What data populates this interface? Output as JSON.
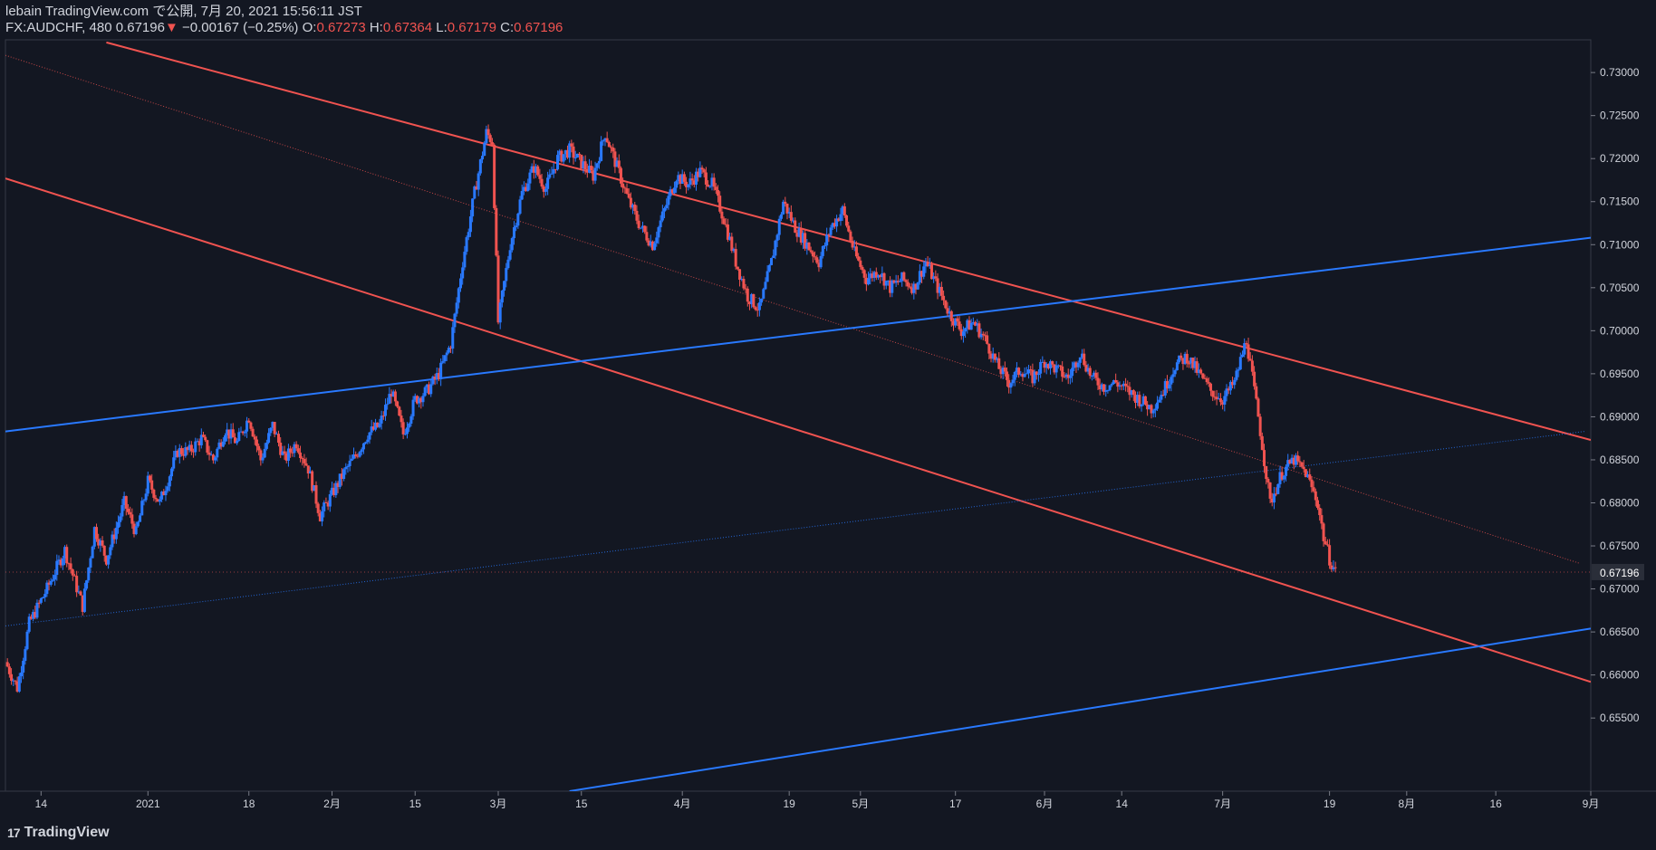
{
  "header": {
    "publish_line": "lebain TradingView.com で公開, 7月 20, 2021 15:56:11 JST",
    "symbol": "FX:AUDCHF, 480",
    "last": "0.67196",
    "down_arrow": "▼",
    "change": "−0.00167 (−0.25%)",
    "o_label": "O:",
    "o_value": "0.67273",
    "h_label": "H:",
    "h_value": "0.67364",
    "l_label": "L:",
    "l_value": "0.67179",
    "c_label": "C:",
    "c_value": "0.67196"
  },
  "footer": {
    "logo_text": "TradingView",
    "logo_mark": "17"
  },
  "colors": {
    "background": "#131722",
    "up": "#2979ff",
    "down": "#f05350",
    "axis_text": "#d1d4dc",
    "price_tag_bg": "#2a2e39"
  },
  "chart_data": {
    "type": "candlestick",
    "symbol": "FX:AUDCHF",
    "interval": "480",
    "price_axis": {
      "range": [
        0.6465,
        0.7338
      ],
      "ticks": [
        "0.73000",
        "0.72500",
        "0.72000",
        "0.71500",
        "0.71000",
        "0.70500",
        "0.70000",
        "0.69500",
        "0.69000",
        "0.68500",
        "0.68000",
        "0.67500",
        "0.67000",
        "0.66500",
        "0.66000",
        "0.65500"
      ],
      "current_price_label": "0.67196"
    },
    "time_axis": {
      "range": [
        "2020-12-08",
        "2021-09-01"
      ],
      "ticks": [
        {
          "date": "2020-12-14",
          "label": "14"
        },
        {
          "date": "2021-01-01",
          "label": "2021"
        },
        {
          "date": "2021-01-18",
          "label": "18"
        },
        {
          "date": "2021-02-01",
          "label": "2月"
        },
        {
          "date": "2021-02-15",
          "label": "15"
        },
        {
          "date": "2021-03-01",
          "label": "3月"
        },
        {
          "date": "2021-03-15",
          "label": "15"
        },
        {
          "date": "2021-04-01",
          "label": "4月"
        },
        {
          "date": "2021-04-19",
          "label": "19"
        },
        {
          "date": "2021-05-01",
          "label": "5月"
        },
        {
          "date": "2021-05-17",
          "label": "17"
        },
        {
          "date": "2021-06-01",
          "label": "6月"
        },
        {
          "date": "2021-06-14",
          "label": "14"
        },
        {
          "date": "2021-07-01",
          "label": "7月"
        },
        {
          "date": "2021-07-19",
          "label": "19"
        },
        {
          "date": "2021-08-01",
          "label": "8月"
        },
        {
          "date": "2021-08-16",
          "label": "16"
        },
        {
          "date": "2021-09-01",
          "label": "9月"
        }
      ]
    },
    "price_path": [
      [
        "2020-12-08",
        0.6615
      ],
      [
        "2020-12-10",
        0.6585
      ],
      [
        "2020-12-12",
        0.666
      ],
      [
        "2020-12-15",
        0.67
      ],
      [
        "2020-12-18",
        0.6745
      ],
      [
        "2020-12-21",
        0.668
      ],
      [
        "2020-12-23",
        0.677
      ],
      [
        "2020-12-25",
        0.6735
      ],
      [
        "2020-12-28",
        0.68
      ],
      [
        "2020-12-30",
        0.6765
      ],
      [
        "2021-01-01",
        0.6825
      ],
      [
        "2021-01-03",
        0.68
      ],
      [
        "2021-01-06",
        0.686
      ],
      [
        "2021-01-08",
        0.686
      ],
      [
        "2021-01-10",
        0.6875
      ],
      [
        "2021-01-12",
        0.685
      ],
      [
        "2021-01-14",
        0.6885
      ],
      [
        "2021-01-16",
        0.687
      ],
      [
        "2021-01-18",
        0.69
      ],
      [
        "2021-01-20",
        0.685
      ],
      [
        "2021-01-22",
        0.689
      ],
      [
        "2021-01-24",
        0.685
      ],
      [
        "2021-01-26",
        0.687
      ],
      [
        "2021-01-28",
        0.684
      ],
      [
        "2021-01-30",
        0.6785
      ],
      [
        "2021-02-01",
        0.681
      ],
      [
        "2021-02-03",
        0.6835
      ],
      [
        "2021-02-05",
        0.6855
      ],
      [
        "2021-02-07",
        0.688
      ],
      [
        "2021-02-09",
        0.689
      ],
      [
        "2021-02-11",
        0.693
      ],
      [
        "2021-02-13",
        0.688
      ],
      [
        "2021-02-15",
        0.692
      ],
      [
        "2021-02-17",
        0.693
      ],
      [
        "2021-02-19",
        0.695
      ],
      [
        "2021-02-21",
        0.6985
      ],
      [
        "2021-02-23",
        0.708
      ],
      [
        "2021-02-25",
        0.716
      ],
      [
        "2021-02-27",
        0.723
      ],
      [
        "2021-02-28",
        0.722
      ],
      [
        "2021-03-01",
        0.701
      ],
      [
        "2021-03-03",
        0.71
      ],
      [
        "2021-03-05",
        0.716
      ],
      [
        "2021-03-07",
        0.719
      ],
      [
        "2021-03-09",
        0.7165
      ],
      [
        "2021-03-11",
        0.72
      ],
      [
        "2021-03-13",
        0.721
      ],
      [
        "2021-03-15",
        0.7195
      ],
      [
        "2021-03-17",
        0.718
      ],
      [
        "2021-03-19",
        0.723
      ],
      [
        "2021-03-21",
        0.719
      ],
      [
        "2021-03-23",
        0.715
      ],
      [
        "2021-03-25",
        0.712
      ],
      [
        "2021-03-27",
        0.71
      ],
      [
        "2021-03-29",
        0.714
      ],
      [
        "2021-03-31",
        0.718
      ],
      [
        "2021-04-02",
        0.717
      ],
      [
        "2021-04-04",
        0.7185
      ],
      [
        "2021-04-06",
        0.717
      ],
      [
        "2021-04-08",
        0.713
      ],
      [
        "2021-04-10",
        0.708
      ],
      [
        "2021-04-12",
        0.704
      ],
      [
        "2021-04-14",
        0.7025
      ],
      [
        "2021-04-16",
        0.708
      ],
      [
        "2021-04-18",
        0.715
      ],
      [
        "2021-04-20",
        0.712
      ],
      [
        "2021-04-22",
        0.71
      ],
      [
        "2021-04-24",
        0.708
      ],
      [
        "2021-04-26",
        0.712
      ],
      [
        "2021-04-28",
        0.714
      ],
      [
        "2021-04-30",
        0.709
      ],
      [
        "2021-05-02",
        0.706
      ],
      [
        "2021-05-04",
        0.707
      ],
      [
        "2021-05-06",
        0.705
      ],
      [
        "2021-05-08",
        0.706
      ],
      [
        "2021-05-10",
        0.705
      ],
      [
        "2021-05-12",
        0.708
      ],
      [
        "2021-05-14",
        0.705
      ],
      [
        "2021-05-16",
        0.702
      ],
      [
        "2021-05-18",
        0.7
      ],
      [
        "2021-05-20",
        0.701
      ],
      [
        "2021-05-22",
        0.699
      ],
      [
        "2021-05-24",
        0.696
      ],
      [
        "2021-05-26",
        0.694
      ],
      [
        "2021-05-28",
        0.6955
      ],
      [
        "2021-05-30",
        0.6945
      ],
      [
        "2021-06-01",
        0.6965
      ],
      [
        "2021-06-03",
        0.6955
      ],
      [
        "2021-06-05",
        0.6945
      ],
      [
        "2021-06-07",
        0.6975
      ],
      [
        "2021-06-09",
        0.6945
      ],
      [
        "2021-06-11",
        0.6935
      ],
      [
        "2021-06-13",
        0.694
      ],
      [
        "2021-06-15",
        0.693
      ],
      [
        "2021-06-17",
        0.692
      ],
      [
        "2021-06-19",
        0.691
      ],
      [
        "2021-06-21",
        0.693
      ],
      [
        "2021-06-23",
        0.696
      ],
      [
        "2021-06-25",
        0.697
      ],
      [
        "2021-06-27",
        0.695
      ],
      [
        "2021-06-29",
        0.693
      ],
      [
        "2021-07-01",
        0.692
      ],
      [
        "2021-07-03",
        0.694
      ],
      [
        "2021-07-05",
        0.699
      ],
      [
        "2021-07-07",
        0.69
      ],
      [
        "2021-07-09",
        0.68
      ],
      [
        "2021-07-11",
        0.6835
      ],
      [
        "2021-07-13",
        0.685
      ],
      [
        "2021-07-15",
        0.6835
      ],
      [
        "2021-07-17",
        0.68
      ],
      [
        "2021-07-18",
        0.676
      ],
      [
        "2021-07-19",
        0.6735
      ],
      [
        "2021-07-20",
        0.672
      ]
    ],
    "trendlines": [
      {
        "color": "down",
        "style": "solid",
        "start": {
          "date": "2020-12-25",
          "price": 0.7335
        },
        "end": {
          "date": "2021-09-01",
          "price": 0.6873
        }
      },
      {
        "color": "down",
        "style": "solid",
        "start": {
          "date": "2020-12-08",
          "price": 0.7177
        },
        "end": {
          "date": "2021-09-01",
          "price": 0.6592
        }
      },
      {
        "color": "down",
        "style": "dotted",
        "start": {
          "date": "2020-12-08",
          "price": 0.732
        },
        "end": {
          "date": "2021-08-30",
          "price": 0.673
        }
      },
      {
        "color": "up",
        "style": "solid",
        "start": {
          "date": "2020-12-08",
          "price": 0.6883
        },
        "end": {
          "date": "2021-09-01",
          "price": 0.7108
        }
      },
      {
        "color": "up",
        "style": "solid",
        "start": {
          "date": "2021-03-13",
          "price": 0.6465
        },
        "end": {
          "date": "2021-09-01",
          "price": 0.6654
        }
      },
      {
        "color": "up",
        "style": "dotted",
        "start": {
          "date": "2020-12-08",
          "price": 0.6657
        },
        "end": {
          "date": "2021-08-31",
          "price": 0.6883
        }
      }
    ]
  }
}
